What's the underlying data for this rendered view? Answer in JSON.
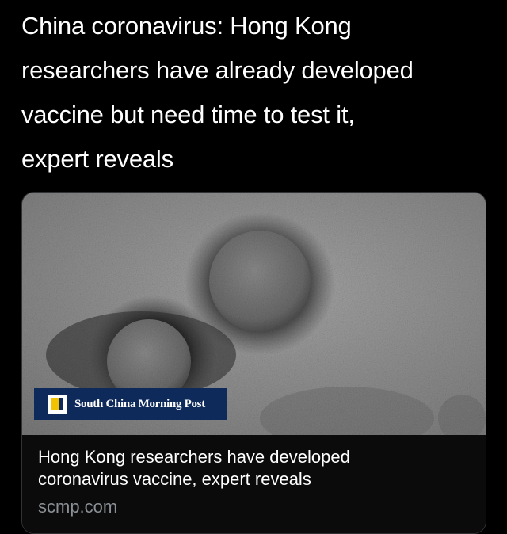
{
  "tweet": {
    "text": "China coronavirus: Hong Kong\nresearchers have already developed\nvaccine but need time to test it,\nexpert reveals"
  },
  "link_card": {
    "image": {
      "subject": "electron-microscope-virus-image",
      "publisher_logo_text": "South China Morning Post"
    },
    "title": "Hong Kong researchers have developed\ncoronavirus vaccine, expert reveals",
    "domain": "scmp.com"
  },
  "colors": {
    "background": "#000000",
    "text_primary": "#ffffff",
    "text_secondary": "#8b9096",
    "card_border": "#2f3336",
    "scmp_navy": "#0e2a5a",
    "scmp_yellow": "#f2c300"
  }
}
